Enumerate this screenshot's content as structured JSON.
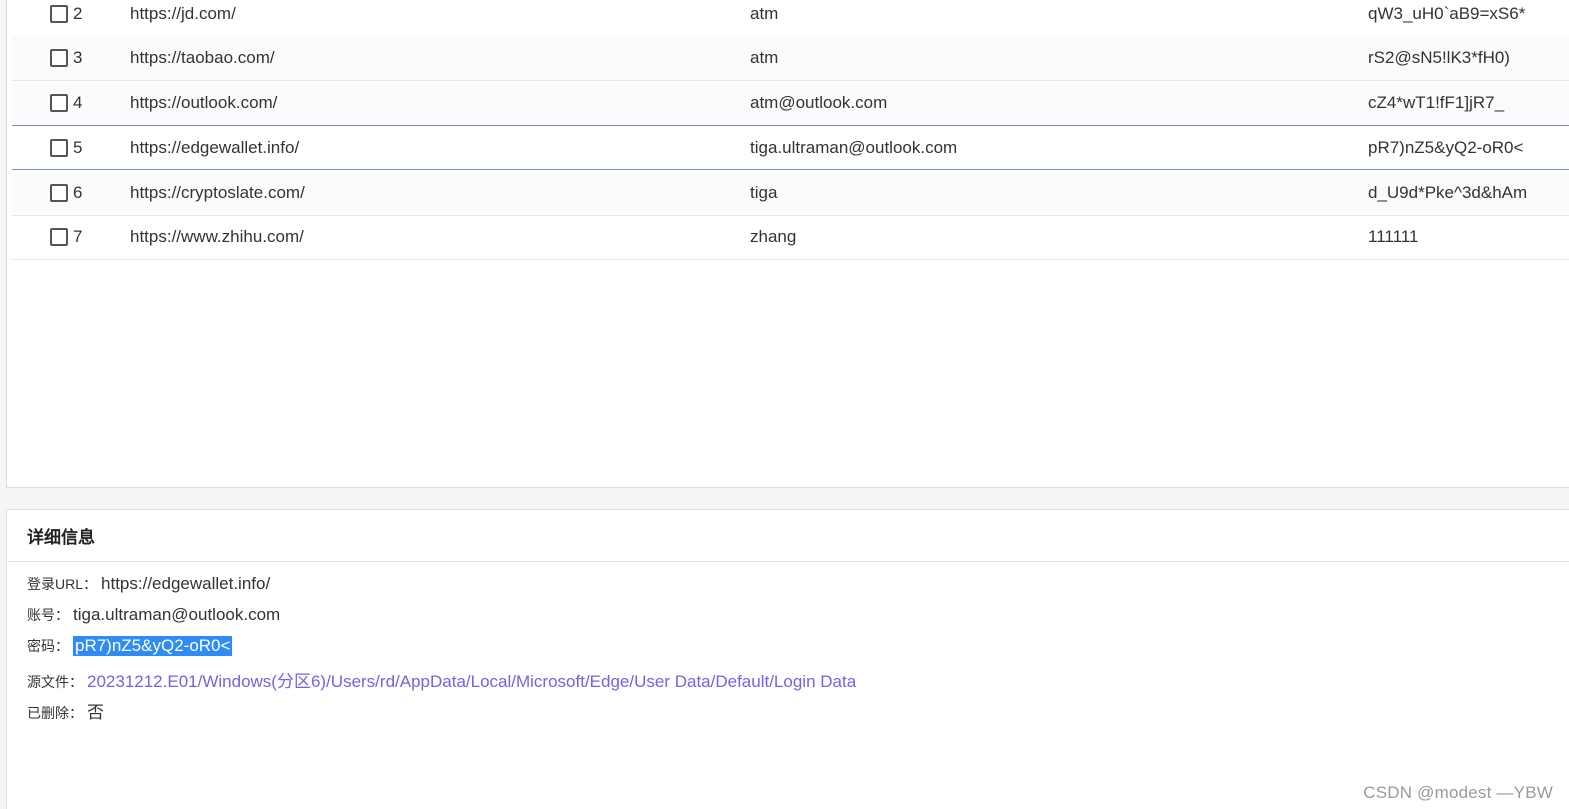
{
  "table": {
    "rows": [
      {
        "index": "2",
        "url": "https://jd.com/",
        "account": "atm",
        "password": "qW3_uH0`aB9=xS6*"
      },
      {
        "index": "3",
        "url": "https://taobao.com/",
        "account": "atm",
        "password": "rS2@sN5!lK3*fH0)"
      },
      {
        "index": "4",
        "url": "https://outlook.com/",
        "account": "atm@outlook.com",
        "password": "cZ4*wT1!fF1]jR7_"
      },
      {
        "index": "5",
        "url": "https://edgewallet.info/",
        "account": "tiga.ultraman@outlook.com",
        "password": "pR7)nZ5&yQ2-oR0<"
      },
      {
        "index": "6",
        "url": "https://cryptoslate.com/",
        "account": "tiga",
        "password": "d_U9d*Pke^3d&hAm"
      },
      {
        "index": "7",
        "url": "https://www.zhihu.com/",
        "account": "zhang",
        "password": "111111"
      }
    ]
  },
  "detail": {
    "title": "详细信息",
    "login_url_label": "登录URL：",
    "login_url_value": "https://edgewallet.info/",
    "account_label": "账号：",
    "account_value": "tiga.ultraman@outlook.com",
    "password_label": "密码：",
    "password_value": "pR7)nZ5&yQ2-oR0<",
    "source_label": "源文件：",
    "source_value": "20231212.E01/Windows(分区6)/Users/rd/AppData/Local/Microsoft/Edge/User Data/Default/Login Data",
    "deleted_label": "已删除：",
    "deleted_value": "否"
  },
  "watermark": "CSDN @modest —YBW",
  "colors": {
    "selection_highlight": "#2f8cf4",
    "link": "#7a5fe0",
    "selected_row_border": "#8a7fd8"
  }
}
